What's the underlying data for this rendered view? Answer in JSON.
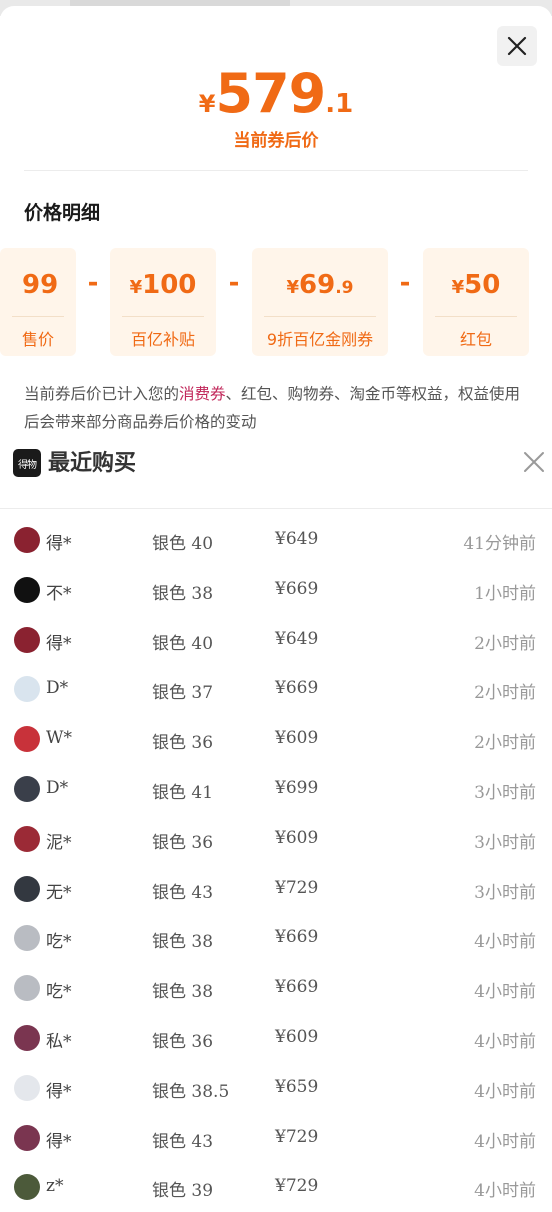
{
  "price": {
    "currency": "¥",
    "integer": "579",
    "decimal": ".1",
    "label": "当前券后价"
  },
  "detail": {
    "title": "价格明细",
    "cards": [
      {
        "currency": "",
        "integer": "99",
        "decimal": "",
        "label": "售价"
      },
      {
        "currency": "¥",
        "integer": "100",
        "decimal": "",
        "label": "百亿补贴"
      },
      {
        "currency": "¥",
        "integer": "69",
        "decimal": ".9",
        "label": "9折百亿金刚券"
      },
      {
        "currency": "¥",
        "integer": "50",
        "decimal": "",
        "label": "红包"
      }
    ],
    "operator": "-",
    "note": {
      "part1": "当前券后价已计入您的",
      "highlight": "消费券",
      "part2": "、红包、购物券、淘金币等权益，权益使用后会带来部分商品券后价格的变动"
    }
  },
  "recent": {
    "logo_text": "得物",
    "title": "最近购买",
    "rows": [
      {
        "user": "得*",
        "spec": "银色 40",
        "price": "¥649",
        "time": "41分钟前",
        "avatar_color": "#8a2230"
      },
      {
        "user": "不*",
        "spec": "银色 38",
        "price": "¥669",
        "time": "1小时前",
        "avatar_color": "#111111"
      },
      {
        "user": "得*",
        "spec": "银色 40",
        "price": "¥649",
        "time": "2小时前",
        "avatar_color": "#8a2230"
      },
      {
        "user": "D*",
        "spec": "银色 37",
        "price": "¥669",
        "time": "2小时前",
        "avatar_color": "#d9e4ee"
      },
      {
        "user": "W*",
        "spec": "银色 36",
        "price": "¥609",
        "time": "2小时前",
        "avatar_color": "#c8323a"
      },
      {
        "user": "D*",
        "spec": "银色 41",
        "price": "¥699",
        "time": "3小时前",
        "avatar_color": "#3a3f4a"
      },
      {
        "user": "泥*",
        "spec": "银色 36",
        "price": "¥609",
        "time": "3小时前",
        "avatar_color": "#9b2a36"
      },
      {
        "user": "无*",
        "spec": "银色 43",
        "price": "¥729",
        "time": "3小时前",
        "avatar_color": "#333840"
      },
      {
        "user": "吃*",
        "spec": "银色 38",
        "price": "¥669",
        "time": "4小时前",
        "avatar_color": "#b9bcc2"
      },
      {
        "user": "吃*",
        "spec": "银色 38",
        "price": "¥669",
        "time": "4小时前",
        "avatar_color": "#b9bcc2"
      },
      {
        "user": "私*",
        "spec": "银色 36",
        "price": "¥609",
        "time": "4小时前",
        "avatar_color": "#7a3550"
      },
      {
        "user": "得*",
        "spec": "银色 38.5",
        "price": "¥659",
        "time": "4小时前",
        "avatar_color": "#e4e7ec"
      },
      {
        "user": "得*",
        "spec": "银色 43",
        "price": "¥729",
        "time": "4小时前",
        "avatar_color": "#7a3550"
      },
      {
        "user": "z*",
        "spec": "银色 39",
        "price": "¥729",
        "time": "4小时前",
        "avatar_color": "#4c5a3a"
      }
    ]
  },
  "colors": {
    "accent": "#f06a15",
    "card_bg": "#fff5ea",
    "highlight": "#c1275a"
  },
  "icons": {
    "close": "close-icon",
    "recent_close": "close-icon"
  }
}
